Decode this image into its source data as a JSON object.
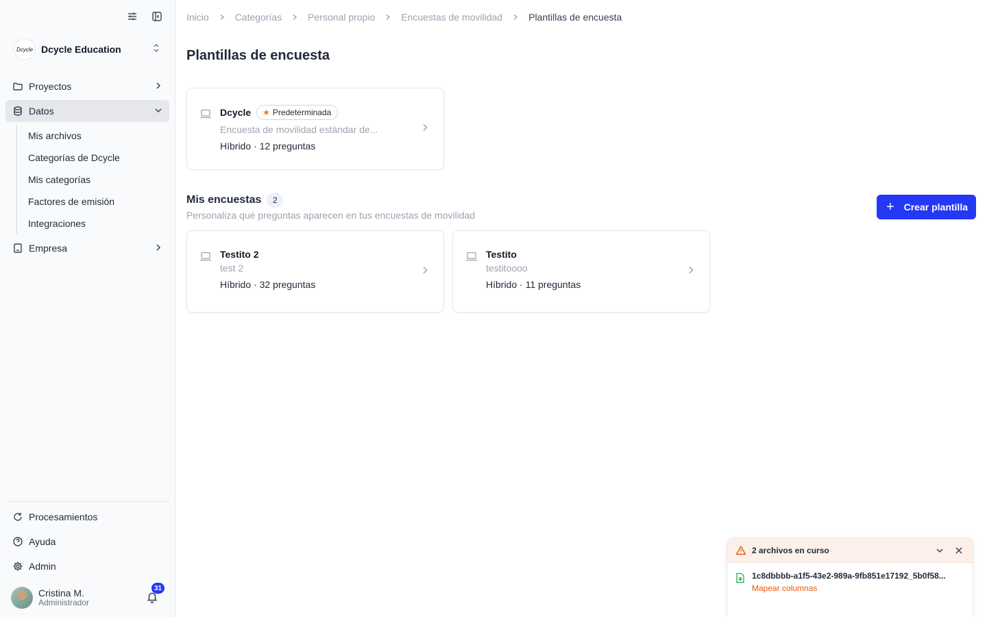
{
  "sidebar": {
    "org_logo_text": "Dcycle",
    "org_name": "Dcycle Education",
    "nav": {
      "proyectos": "Proyectos",
      "datos": "Datos",
      "datos_sub": [
        "Mis archivos",
        "Categorías de Dcycle",
        "Mis categorías",
        "Factores de emisión",
        "Integraciones"
      ],
      "empresa": "Empresa"
    },
    "bottom": {
      "procesamientos": "Procesamientos",
      "ayuda": "Ayuda",
      "admin": "Admin"
    },
    "user": {
      "name": "Cristina M.",
      "role": "Administrador",
      "notifications": "31"
    }
  },
  "breadcrumb": [
    "Inicio",
    "Categorías",
    "Personal propio",
    "Encuestas de movilidad",
    "Plantillas de encuesta"
  ],
  "page_title": "Plantillas de encuesta",
  "default_template": {
    "title": "Dcycle",
    "badge": "Predeterminada",
    "description": "Encuesta de movilidad estándar de...",
    "meta": "Híbrido · 12 preguntas"
  },
  "my_surveys": {
    "title": "Mis encuestas",
    "count": "2",
    "subtitle": "Personaliza qué preguntas aparecen en tus encuestas de movilidad",
    "create_label": "Crear plantilla",
    "items": [
      {
        "title": "Testito 2",
        "description": "test 2",
        "meta": "Híbrido · 32 preguntas"
      },
      {
        "title": "Testito",
        "description": "testitoooo",
        "meta": "Híbrido · 11 preguntas"
      }
    ]
  },
  "uploads": {
    "title": "2 archivos en curso",
    "file_name": "1c8dbbbb-a1f5-43e2-989a-9fb851e17192_5b0f58...",
    "file_action": "Mapear columnas"
  },
  "colors": {
    "accent": "#2438f5",
    "warning": "#ea580c",
    "star": "#f97316"
  }
}
